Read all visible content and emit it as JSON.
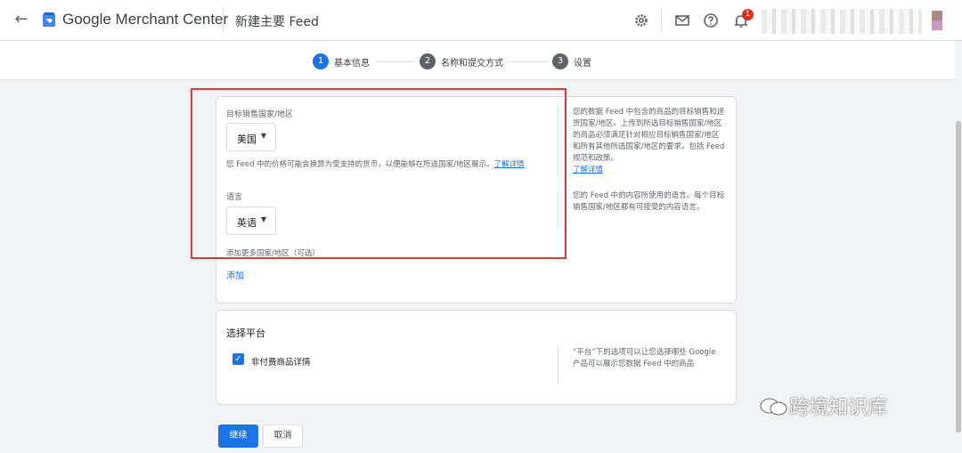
{
  "topbar": {
    "back_icon": "arrow-left-icon",
    "brand": "Google Merchant Center",
    "page_title": "新建主要 Feed",
    "icons": [
      "gear-icon",
      "mail-icon",
      "help-icon",
      "bell-icon"
    ],
    "notification_count": "1"
  },
  "stepper": {
    "steps": [
      {
        "number": "1",
        "label": "基本信息"
      },
      {
        "number": "2",
        "label": "名称和提交方式"
      },
      {
        "number": "3",
        "label": "设置"
      }
    ],
    "active_color": "#1a73e8",
    "inactive_color": "#5f6368"
  },
  "country_section": {
    "label": "目标销售国家/地区",
    "selected": "美国",
    "note": "您 Feed 中的价格可能会换算为受支持的货币，以便能够在所选国家/地区展示。",
    "note_link": "了解详情",
    "help": "您的数据 Feed 中包含的商品的目标销售和送货国家/地区。上传到所选目标销售国家/地区的商品必须满足针对相应目标销售国家/地区和所有其他所选国家/地区的要求，包括 Feed 规范和政策。",
    "help_link": "了解详情"
  },
  "language_section": {
    "label": "语言",
    "selected": "英语",
    "help": "您的 Feed 中的内容所使用的语言。每个目标销售国家/地区都有可接受的内容语言。",
    "add_more_label": "添加更多国家/地区（可选）",
    "add_link": "添加"
  },
  "platform_section": {
    "title": "选择平台",
    "checkbox_label": "非付费商品详情",
    "checked": true,
    "help": "“平台”下的选项可以让您选择哪些 Google 产品可以展示您数据 Feed 中的商品"
  },
  "actions": {
    "continue": "继续",
    "cancel": "取消"
  },
  "watermark": "跨境知识库"
}
